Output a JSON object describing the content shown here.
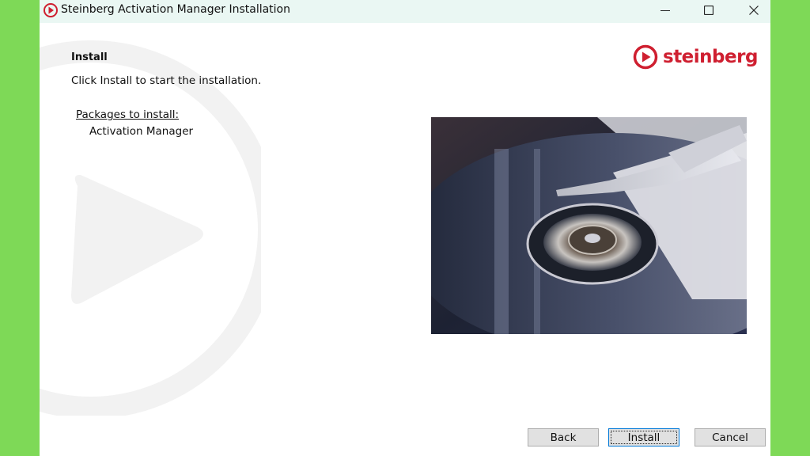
{
  "window": {
    "title": "Steinberg Activation Manager Installation"
  },
  "page": {
    "heading": "Install",
    "instruction": "Click Install to start the installation.",
    "packages_label": "Packages to install:",
    "packages": [
      "Activation Manager"
    ]
  },
  "brand": {
    "name": "steinberg",
    "color": "#cf1f30"
  },
  "buttons": {
    "back": "Back",
    "install": "Install",
    "cancel": "Cancel"
  },
  "icons": {
    "title": "steinberg-logo-icon",
    "minimize": "minimize-icon",
    "maximize": "maximize-icon",
    "close": "close-icon"
  },
  "colors": {
    "background": "#7ed957",
    "titlebar": "#eaf7f3",
    "button_face": "#e1e1e1",
    "focus_border": "#0078d7"
  }
}
